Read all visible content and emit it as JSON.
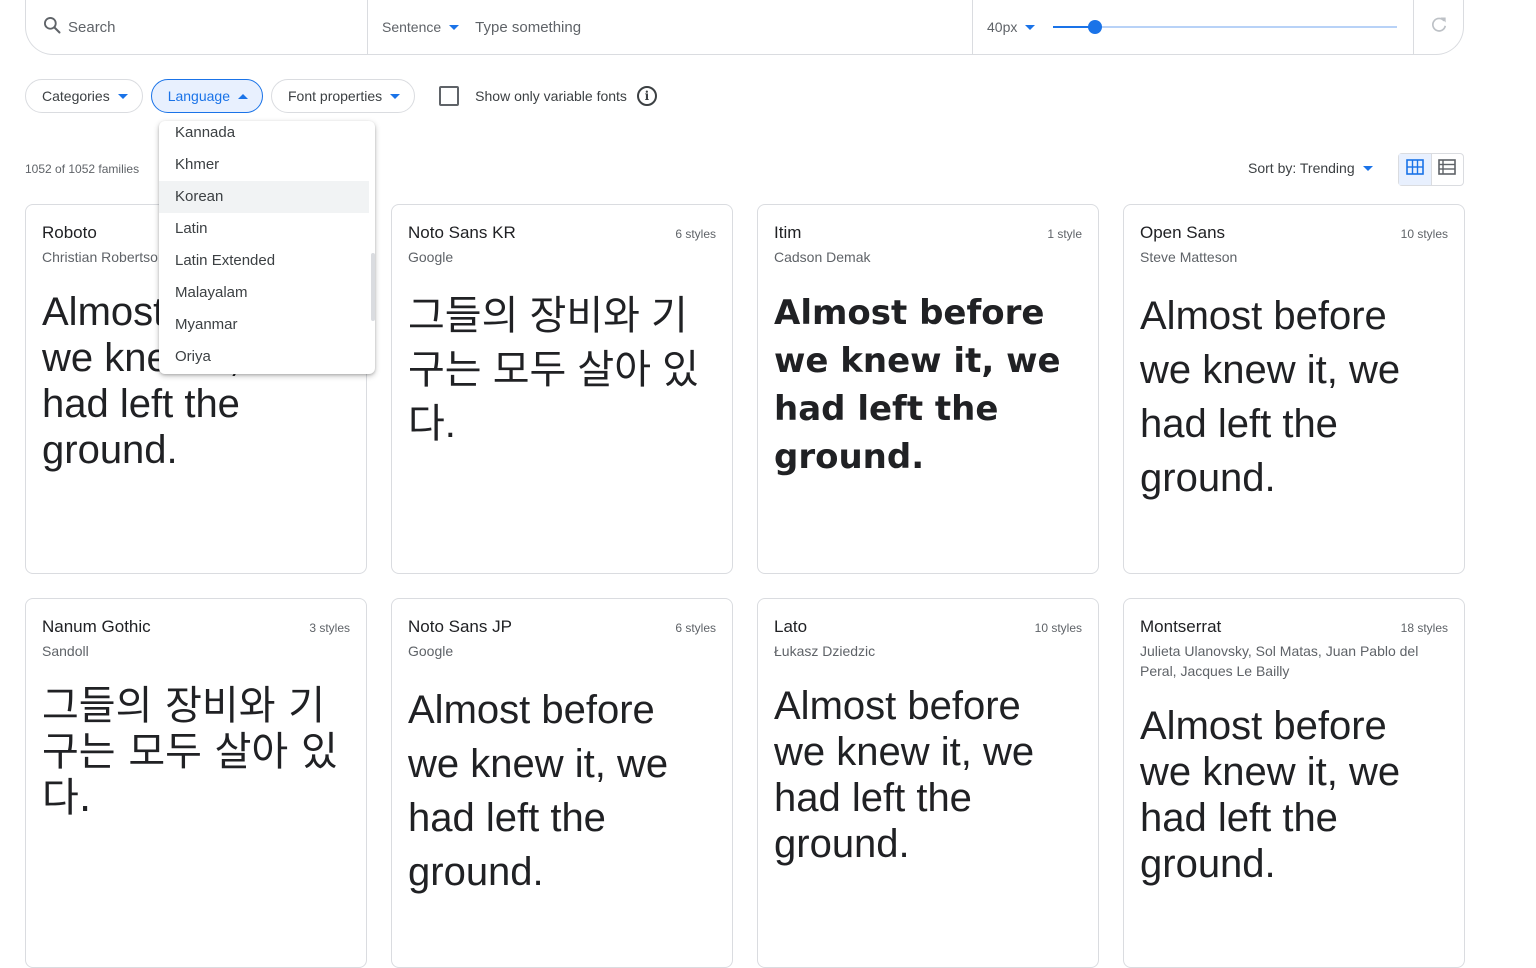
{
  "toolbar": {
    "search_placeholder": "Search",
    "sentence_label": "Sentence",
    "type_placeholder": "Type something",
    "size_label": "40px",
    "size_slider_fraction": 0.12,
    "colors": {
      "accent": "#1a73e8",
      "border": "#dadce0"
    }
  },
  "filters": {
    "categories": "Categories",
    "language": "Language",
    "font_properties": "Font properties",
    "variable_only": "Show only variable fonts"
  },
  "language_menu": {
    "items": [
      "Kannada",
      "Khmer",
      "Korean",
      "Latin",
      "Latin Extended",
      "Malayalam",
      "Myanmar",
      "Oriya"
    ],
    "hovered": "Korean"
  },
  "results": {
    "count": "1052 of 1052 families",
    "sort": "Sort by: Trending"
  },
  "cards": [
    {
      "name": "Roboto",
      "designer": "Christian Robertson",
      "styles": "",
      "sample": "Almost before we knew it, we had left the ground."
    },
    {
      "name": "Noto Sans KR",
      "designer": "Google",
      "styles": "6 styles",
      "sample": "그들의 장비와 기구는 모두 살아 있다."
    },
    {
      "name": "Itim",
      "designer": "Cadson Demak",
      "styles": "1 style",
      "sample": "Almost before we knew it, we had left the ground."
    },
    {
      "name": "Open Sans",
      "designer": "Steve Matteson",
      "styles": "10 styles",
      "sample": "Almost before we knew it, we had left the ground."
    },
    {
      "name": "Nanum Gothic",
      "designer": "Sandoll",
      "styles": "3 styles",
      "sample": "그들의 장비와 기구는 모두 살아 있다."
    },
    {
      "name": "Noto Sans JP",
      "designer": "Google",
      "styles": "6 styles",
      "sample": "Almost before we knew it, we had left the ground."
    },
    {
      "name": "Lato",
      "designer": "Łukasz Dziedzic",
      "styles": "10 styles",
      "sample": "Almost before we knew it, we had left the ground."
    },
    {
      "name": "Montserrat",
      "designer": "Julieta Ulanovsky, Sol Matas, Juan Pablo del Peral, Jacques Le Bailly",
      "styles": "18 styles",
      "sample": "Almost before we knew it, we had left the ground."
    }
  ]
}
